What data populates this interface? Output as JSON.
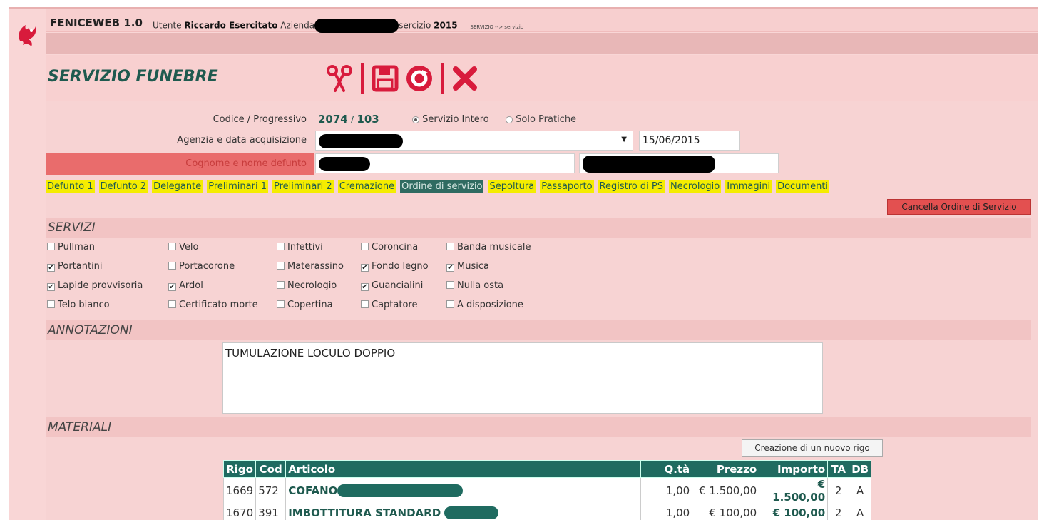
{
  "header": {
    "app_name": "FENICEWEB 1.0",
    "user_prefix": "Utente",
    "user_name": "Riccardo Esercitato",
    "azienda_prefix": "Azienda",
    "esercizio_suffix": "sercizio",
    "year": "2015",
    "breadcrumb": "SERVIZIO --> servizio"
  },
  "page": {
    "title": "SERVIZIO FUNEBRE"
  },
  "toolbar": {
    "icons": [
      "scissors-icon",
      "save-icon",
      "refresh-icon",
      "close-icon"
    ],
    "accent": "#d81b3c"
  },
  "form": {
    "codice_label": "Codice / Progressivo",
    "codice": "2074",
    "progressivo_sep": "/",
    "progressivo": "103",
    "radio_intero": "Servizio Intero",
    "radio_pratiche": "Solo Pratiche",
    "agenzia_label": "Agenzia e data acquisizione",
    "data": "15/06/2015",
    "cognome_label": "Cognome e nome defunto"
  },
  "tabs": [
    {
      "label": "Defunto 1"
    },
    {
      "label": "Defunto 2"
    },
    {
      "label": "Delegante"
    },
    {
      "label": "Preliminari 1"
    },
    {
      "label": "Preliminari 2"
    },
    {
      "label": "Cremazione"
    },
    {
      "label": "Ordine di servizio"
    },
    {
      "label": "Sepoltura"
    },
    {
      "label": "Passaporto"
    },
    {
      "label": "Registro di PS"
    },
    {
      "label": "Necrologio"
    },
    {
      "label": "Immagini"
    },
    {
      "label": "Documenti"
    }
  ],
  "active_tab": "Ordine di servizio",
  "cancel_button": "Cancella Ordine di Servizio",
  "sections": {
    "servizi": "SERVIZI",
    "annotazioni": "ANNOTAZIONI",
    "materiali": "MATERIALI"
  },
  "servizi": [
    {
      "label": "Pullman",
      "checked": false
    },
    {
      "label": "Velo",
      "checked": false
    },
    {
      "label": "Infettivi",
      "checked": false
    },
    {
      "label": "Coroncina",
      "checked": false
    },
    {
      "label": "Banda musicale",
      "checked": false
    },
    {
      "label": "Portantini",
      "checked": true
    },
    {
      "label": "Portacorone",
      "checked": false
    },
    {
      "label": "Materassino",
      "checked": false
    },
    {
      "label": "Fondo legno",
      "checked": true
    },
    {
      "label": "Musica",
      "checked": true
    },
    {
      "label": "Lapide provvisoria",
      "checked": true
    },
    {
      "label": "Ardol",
      "checked": true
    },
    {
      "label": "Necrologio",
      "checked": false
    },
    {
      "label": "Guancialini",
      "checked": true
    },
    {
      "label": "Nulla osta",
      "checked": false
    },
    {
      "label": "Telo bianco",
      "checked": false
    },
    {
      "label": "Certificato morte",
      "checked": false
    },
    {
      "label": "Copertina",
      "checked": false
    },
    {
      "label": "Captatore",
      "checked": false
    },
    {
      "label": "A disposizione",
      "checked": false
    }
  ],
  "annotazioni_text": "TUMULAZIONE LOCULO DOPPIO",
  "new_row_button": "Creazione di un nuovo rigo",
  "materiali": {
    "columns": [
      "Rigo",
      "Cod",
      "Articolo",
      "Q.tà",
      "Prezzo",
      "Importo",
      "TA",
      "DB"
    ],
    "rows": [
      {
        "rigo": "1669",
        "cod": "572",
        "articolo": "COFANO",
        "qta": "1,00",
        "prezzo": "€ 1.500,00",
        "importo": "€ 1.500,00",
        "ta": "2",
        "db": "A"
      },
      {
        "rigo": "1670",
        "cod": "391",
        "articolo": "IMBOTTITURA STANDARD",
        "qta": "1,00",
        "prezzo": "€ 100,00",
        "importo": "€ 100,00",
        "ta": "2",
        "db": "A"
      }
    ]
  }
}
